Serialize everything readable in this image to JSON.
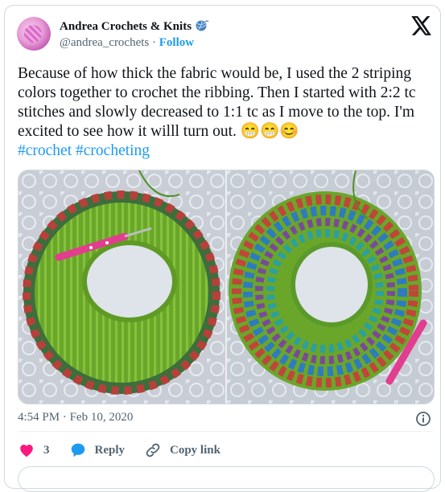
{
  "author": {
    "name": "Andrea Crochets & Knits",
    "handle": "@andrea_crochets",
    "separator": "·",
    "follow_label": "Follow"
  },
  "tweet": {
    "text": "Because of how thick the fabric would be, I used the 2 striping colors together to crochet the ribbing. Then I started with 2:2 tc stitches and slowly decreased to 1:1 tc as I move to the top. I'm excited to see how it willl turn out. 😁😁😊",
    "hashtags": [
      "#crochet",
      "#crocheting"
    ],
    "timestamp": "4:54 PM · Feb 10, 2020"
  },
  "actions": {
    "like_count": "3",
    "reply_label": "Reply",
    "copy_label": "Copy link"
  },
  "icons": {
    "brand": "x-logo-icon",
    "name_emoji": "yarn-ball-icon",
    "info": "info-icon",
    "like": "heart-icon",
    "reply": "speech-bubble-icon",
    "copy": "link-icon"
  },
  "colors": {
    "link": "#1d9bf0",
    "like": "#f91880",
    "reply": "#1d9bf0",
    "muted": "#536471"
  }
}
